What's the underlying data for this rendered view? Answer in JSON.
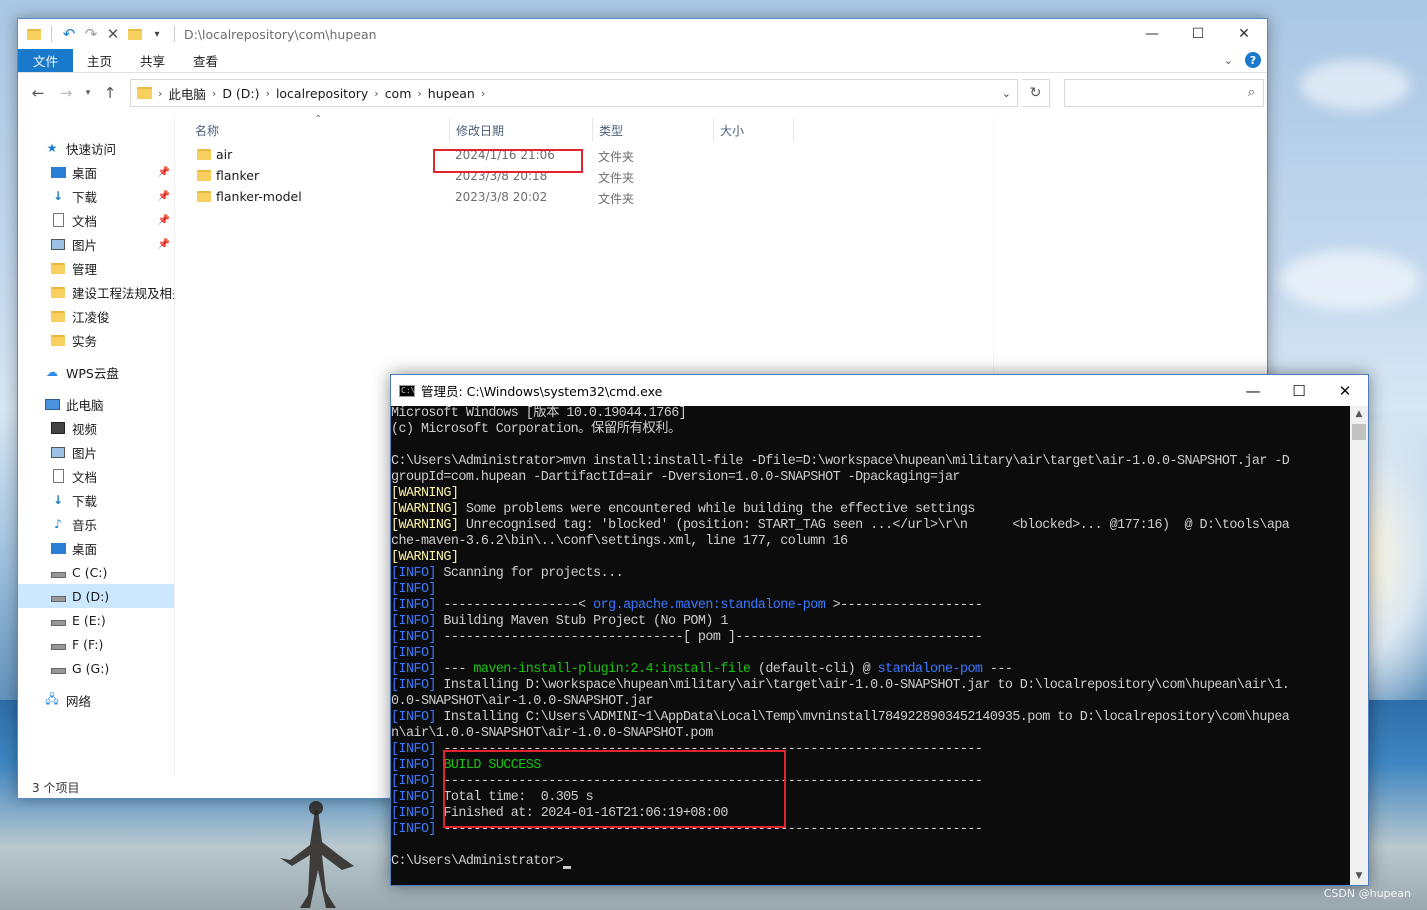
{
  "explorer": {
    "title_path": "D:\\localrepository\\com\\hupean",
    "ribbon_tabs": [
      "文件",
      "主页",
      "共享",
      "查看"
    ],
    "breadcrumbs": [
      "此电脑",
      "D (D:)",
      "localrepository",
      "com",
      "hupean"
    ],
    "search_placeholder": "",
    "columns": [
      "名称",
      "修改日期",
      "类型",
      "大小"
    ],
    "files": [
      {
        "name": "air",
        "date": "2024/1/16 21:06",
        "type": "文件夹"
      },
      {
        "name": "flanker",
        "date": "2023/3/8 20:18",
        "type": "文件夹"
      },
      {
        "name": "flanker-model",
        "date": "2023/3/8 20:02",
        "type": "文件夹"
      }
    ],
    "sidebar": {
      "quick_access": "快速访问",
      "quick_items": [
        "桌面",
        "下载",
        "文档",
        "图片",
        "管理",
        "建设工程法规及相关",
        "江凌俊",
        "实务"
      ],
      "wps": "WPS云盘",
      "this_pc": "此电脑",
      "pc_items": [
        "视频",
        "图片",
        "文档",
        "下载",
        "音乐",
        "桌面",
        "C (C:)",
        "D (D:)",
        "E (E:)",
        "F (F:)",
        "G (G:)"
      ],
      "network": "网络"
    },
    "status": "3 个项目",
    "colors": {
      "accent": "#1979ca",
      "selected": "#cce8ff",
      "highlight_box": "#e0262c"
    }
  },
  "cmd": {
    "title": "管理员: C:\\Windows\\system32\\cmd.exe",
    "lines": [
      [
        {
          "t": "Microsoft Windows [版本 10.0.19044.1766]"
        }
      ],
      [
        {
          "t": "(c) Microsoft Corporation。保留所有权利。"
        }
      ],
      [
        {
          "t": ""
        }
      ],
      [
        {
          "t": "C:\\Users\\Administrator>mvn install:install-file -Dfile=D:\\workspace\\hupean\\military\\air\\target\\air-1.0.0-SNAPSHOT.jar -D"
        }
      ],
      [
        {
          "t": "groupId=com.hupean -DartifactId=air -Dversion=1.0.0-SNAPSHOT -Dpackaging=jar"
        }
      ],
      [
        {
          "t": "[WARNING]",
          "c": "y"
        }
      ],
      [
        {
          "t": "[WARNING]",
          "c": "y"
        },
        {
          "t": " Some problems were encountered while building the effective settings"
        }
      ],
      [
        {
          "t": "[WARNING]",
          "c": "y"
        },
        {
          "t": " Unrecognised tag: 'blocked' (position: START_TAG seen ...</url>\\r\\n      <blocked>... @177:16)  @ D:\\tools\\apa"
        }
      ],
      [
        {
          "t": "che-maven-3.6.2\\bin\\..\\conf\\settings.xml, line 177, column 16"
        }
      ],
      [
        {
          "t": "[WARNING]",
          "c": "y"
        }
      ],
      [
        {
          "t": "[INFO]",
          "c": "b"
        },
        {
          "t": " Scanning for projects..."
        }
      ],
      [
        {
          "t": "[INFO]",
          "c": "b"
        }
      ],
      [
        {
          "t": "[INFO]",
          "c": "b"
        },
        {
          "t": " ------------------< "
        },
        {
          "t": "org.apache.maven:standalone-pom",
          "c": "b"
        },
        {
          "t": " >-------------------"
        }
      ],
      [
        {
          "t": "[INFO]",
          "c": "b"
        },
        {
          "t": " Building Maven Stub Project (No POM) 1"
        }
      ],
      [
        {
          "t": "[INFO]",
          "c": "b"
        },
        {
          "t": " --------------------------------[ pom ]---------------------------------"
        }
      ],
      [
        {
          "t": "[INFO]",
          "c": "b"
        }
      ],
      [
        {
          "t": "[INFO]",
          "c": "b"
        },
        {
          "t": " --- "
        },
        {
          "t": "maven-install-plugin:2.4:install-file",
          "c": "g"
        },
        {
          "t": " (default-cli) @ "
        },
        {
          "t": "standalone-pom",
          "c": "b"
        },
        {
          "t": " ---"
        }
      ],
      [
        {
          "t": "[INFO]",
          "c": "b"
        },
        {
          "t": " Installing D:\\workspace\\hupean\\military\\air\\target\\air-1.0.0-SNAPSHOT.jar to D:\\localrepository\\com\\hupean\\air\\1."
        }
      ],
      [
        {
          "t": "0.0-SNAPSHOT\\air-1.0.0-SNAPSHOT.jar"
        }
      ],
      [
        {
          "t": "[INFO]",
          "c": "b"
        },
        {
          "t": " Installing C:\\Users\\ADMINI~1\\AppData\\Local\\Temp\\mvninstall7849228903452140935.pom to D:\\localrepository\\com\\hupea"
        }
      ],
      [
        {
          "t": "n\\air\\1.0.0-SNAPSHOT\\air-1.0.0-SNAPSHOT.pom"
        }
      ],
      [
        {
          "t": "[INFO]",
          "c": "b"
        },
        {
          "t": " ------------------------------------------------------------------------"
        }
      ],
      [
        {
          "t": "[INFO]",
          "c": "b"
        },
        {
          "t": " "
        },
        {
          "t": "BUILD SUCCESS",
          "c": "g"
        }
      ],
      [
        {
          "t": "[INFO]",
          "c": "b"
        },
        {
          "t": " ------------------------------------------------------------------------"
        }
      ],
      [
        {
          "t": "[INFO]",
          "c": "b"
        },
        {
          "t": " Total time:  0.305 s"
        }
      ],
      [
        {
          "t": "[INFO]",
          "c": "b"
        },
        {
          "t": " Finished at: 2024-01-16T21:06:19+08:00"
        }
      ],
      [
        {
          "t": "[INFO]",
          "c": "b"
        },
        {
          "t": " ------------------------------------------------------------------------"
        }
      ],
      [
        {
          "t": ""
        }
      ],
      [
        {
          "t": "C:\\Users\\Administrator>"
        }
      ]
    ]
  },
  "watermark": "CSDN @hupean"
}
